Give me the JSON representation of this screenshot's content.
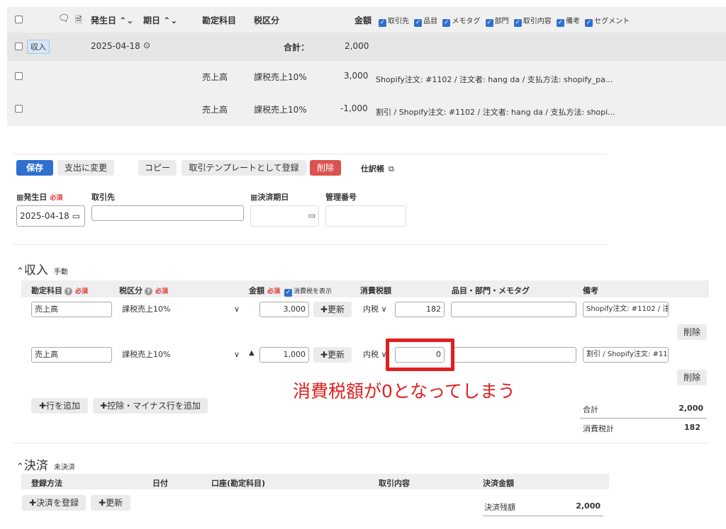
{
  "top_table": {
    "headers": {
      "issue_date": "発生日",
      "due_date": "期日",
      "account": "勘定科目",
      "tax": "税区分",
      "amount": "金額"
    },
    "column_toggles": [
      "取引先",
      "品目",
      "メモタグ",
      "部門",
      "取引内容",
      "備考",
      "セグメント"
    ],
    "summary_row": {
      "type_badge": "収入",
      "date": "2025-04-18",
      "total_label": "合計：",
      "total_value": "2,000"
    },
    "lines": [
      {
        "account": "売上高",
        "tax": "課税売上10%",
        "amount": "3,000",
        "memo": "Shopify注文: #1102 / 注文者: hang da / 支払方法: shopify_pa..."
      },
      {
        "account": "売上高",
        "tax": "課税売上10%",
        "amount": "-1,000",
        "memo": "割引 / Shopify注文: #1102 / 注文者: hang da / 支払方法: shopi..."
      }
    ]
  },
  "toolbar": {
    "save": "保存",
    "to_expense": "支出に変更",
    "copy": "コピー",
    "template": "取引テンプレートとして登録",
    "delete": "削除",
    "journal": "仕訳帳"
  },
  "form": {
    "issue_date_label": "発生日",
    "required": "必須",
    "issue_date_value": "2025-04-18",
    "partner_label": "取引先",
    "due_date_label": "決済期日",
    "mgmt_no_label": "管理番号"
  },
  "income_section": {
    "title": "収入",
    "mode": "手動",
    "col_account": "勘定科目",
    "col_tax": "税区分",
    "col_amount": "金額",
    "show_tax_label": "消費税を表示",
    "col_tax_amount": "消費税額",
    "col_items": "品目・部門・メモタグ",
    "col_memo": "備考",
    "update": "更新",
    "tax_mode": "内税",
    "delete": "削除",
    "rows": [
      {
        "account": "売上高",
        "tax": "課税売上10%",
        "amount": "3,000",
        "tax_amount": "182",
        "memo": "Shopify注文: #1102 / 注:"
      },
      {
        "account": "売上高",
        "tax": "課税売上10%",
        "sign": "▲",
        "amount": "1,000",
        "tax_amount": "0",
        "memo": "割引 / Shopify注文: #110"
      }
    ],
    "add_row": "行を追加",
    "add_minus_row": "控除・マイナス行を追加",
    "total_label": "合計",
    "total_value": "2,000",
    "tax_total_label": "消費税計",
    "tax_total_value": "182",
    "annotation": "消費税額が0となってしまう",
    "annotation_color": "#e02020"
  },
  "settlement_section": {
    "title": "決済",
    "status": "未決済",
    "col_method": "登録方法",
    "col_date": "日付",
    "col_account": "口座(勘定科目)",
    "col_content": "取引内容",
    "col_amount": "決済金額",
    "register": "決済を登録",
    "update": "更新",
    "balance_label": "決済残額",
    "balance_value": "2,000"
  },
  "colors": {
    "primary": "#2f6fce",
    "danger": "#d9534f",
    "highlight": "#e02020"
  }
}
